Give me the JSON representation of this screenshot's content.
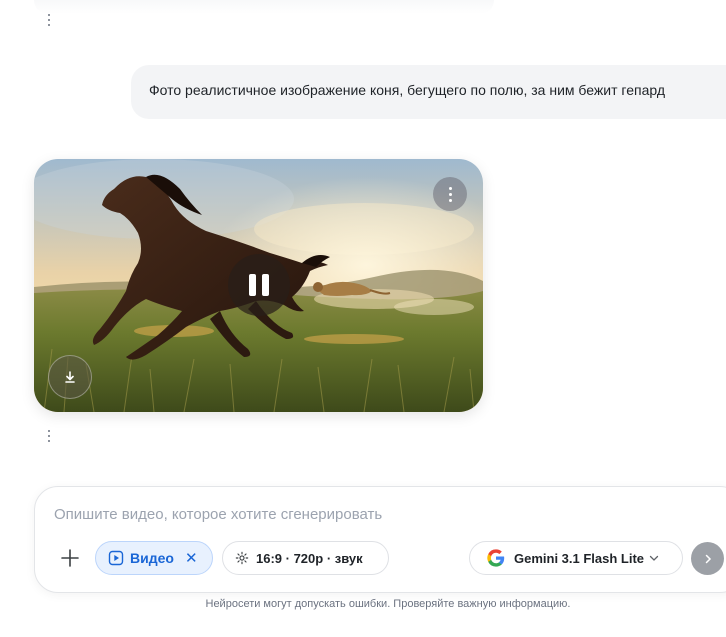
{
  "conversation": {
    "user_message": "Фото реалистичное изображение коня, бегущего по полю, за ним бежит гепард"
  },
  "video_player": {
    "state": "playing"
  },
  "composer": {
    "placeholder": "Опишите видео, которое хотите сгенерировать",
    "mode_chip_label": "Видео",
    "settings_chip_label": "16:9 · 720p · звук",
    "model_chip_label": "Gemini 3.1 Flash Lite"
  },
  "footer": {
    "disclaimer": "Нейросети могут допускать ошибки. Проверяйте важную информацию."
  },
  "icons": {
    "mode": "play-square-icon",
    "settings": "gear-icon",
    "model": "google-g-icon",
    "send": "chevron-right-icon",
    "add": "plus-icon",
    "download": "download-icon"
  },
  "colors": {
    "accent": "#1a66d6",
    "chip_bg": "#e8f1fe",
    "bubble_bg": "#f3f4f6",
    "send_disabled": "#9ca0a6"
  }
}
